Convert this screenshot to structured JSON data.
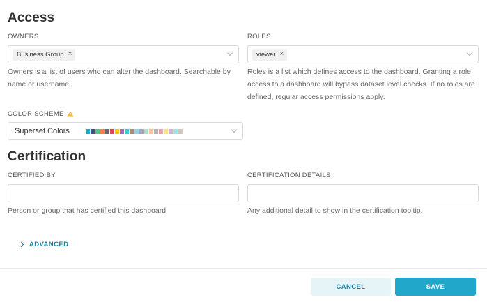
{
  "access": {
    "title": "Access",
    "owners": {
      "label": "OWNERS",
      "tags": [
        "Business Group"
      ],
      "help": "Owners is a list of users who can alter the dashboard. Searchable by name or username."
    },
    "roles": {
      "label": "ROLES",
      "tags": [
        "viewer"
      ],
      "help": "Roles is a list which defines access to the dashboard. Granting a role access to a dashboard will bypass dataset level checks. If no roles are defined, regular access permissions apply."
    },
    "color_scheme": {
      "label": "COLOR SCHEME",
      "value": "Superset Colors",
      "warning_icon": "warning-triangle-icon",
      "swatches": [
        "#1FA8C9",
        "#454E7C",
        "#5AC189",
        "#FF7F44",
        "#666666",
        "#E04355",
        "#FCC700",
        "#A868B7",
        "#3CCCCB",
        "#A38F79",
        "#8FD3E4",
        "#A1A6BD",
        "#ACE1C4",
        "#FEC0A1",
        "#B2B2B2",
        "#EFA1AA",
        "#FDE380",
        "#D3B3DA",
        "#9EE5E5",
        "#D1C6BC"
      ]
    }
  },
  "certification": {
    "title": "Certification",
    "certified_by": {
      "label": "CERTIFIED BY",
      "value": "",
      "help": "Person or group that has certified this dashboard."
    },
    "details": {
      "label": "CERTIFICATION DETAILS",
      "value": "",
      "help": "Any additional detail to show in the certification tooltip."
    }
  },
  "advanced": {
    "label": "ADVANCED",
    "icon": "chevron-right-icon"
  },
  "footer": {
    "cancel_label": "CANCEL",
    "save_label": "SAVE"
  },
  "colors": {
    "accent": "#20A7C9",
    "accent_text": "#1F7D9C",
    "cancel_bg": "#E6F4F8",
    "warning": "#F0B429"
  }
}
